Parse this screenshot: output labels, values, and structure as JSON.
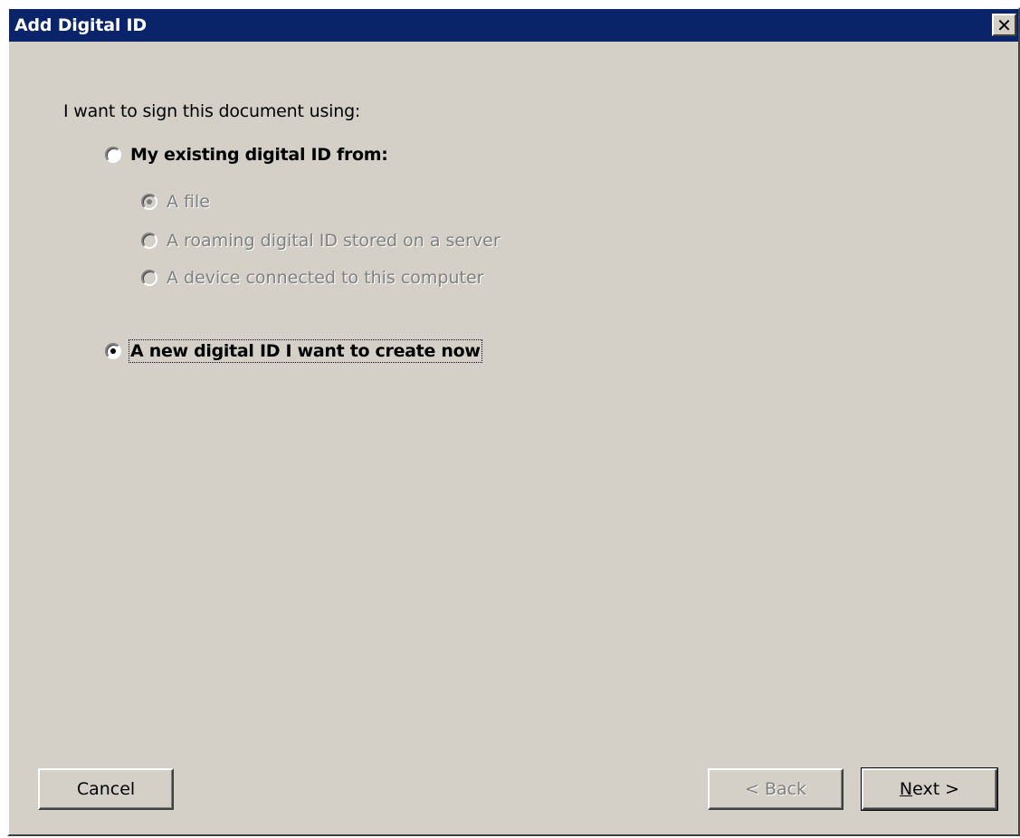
{
  "window": {
    "title": "Add Digital ID",
    "close_symbol": "✕"
  },
  "intro_text": "I want to sign this document using:",
  "options": {
    "existing": {
      "label": "My existing digital ID from:",
      "selected": false
    },
    "sub_options": [
      {
        "label": "A file",
        "selected": true,
        "enabled": false
      },
      {
        "label": "A roaming digital ID stored on a server",
        "selected": false,
        "enabled": false
      },
      {
        "label": "A device connected to this computer",
        "selected": false,
        "enabled": false
      }
    ],
    "new_id": {
      "label": "A new digital ID I want to create now",
      "selected": true
    }
  },
  "buttons": {
    "cancel": "Cancel",
    "back": "< Back",
    "next_mnemonic": "N",
    "next_rest": "ext >"
  },
  "colors": {
    "titlebar": "#0a246a",
    "dialog_bg": "#d4d0c8",
    "disabled_text": "#808080"
  }
}
